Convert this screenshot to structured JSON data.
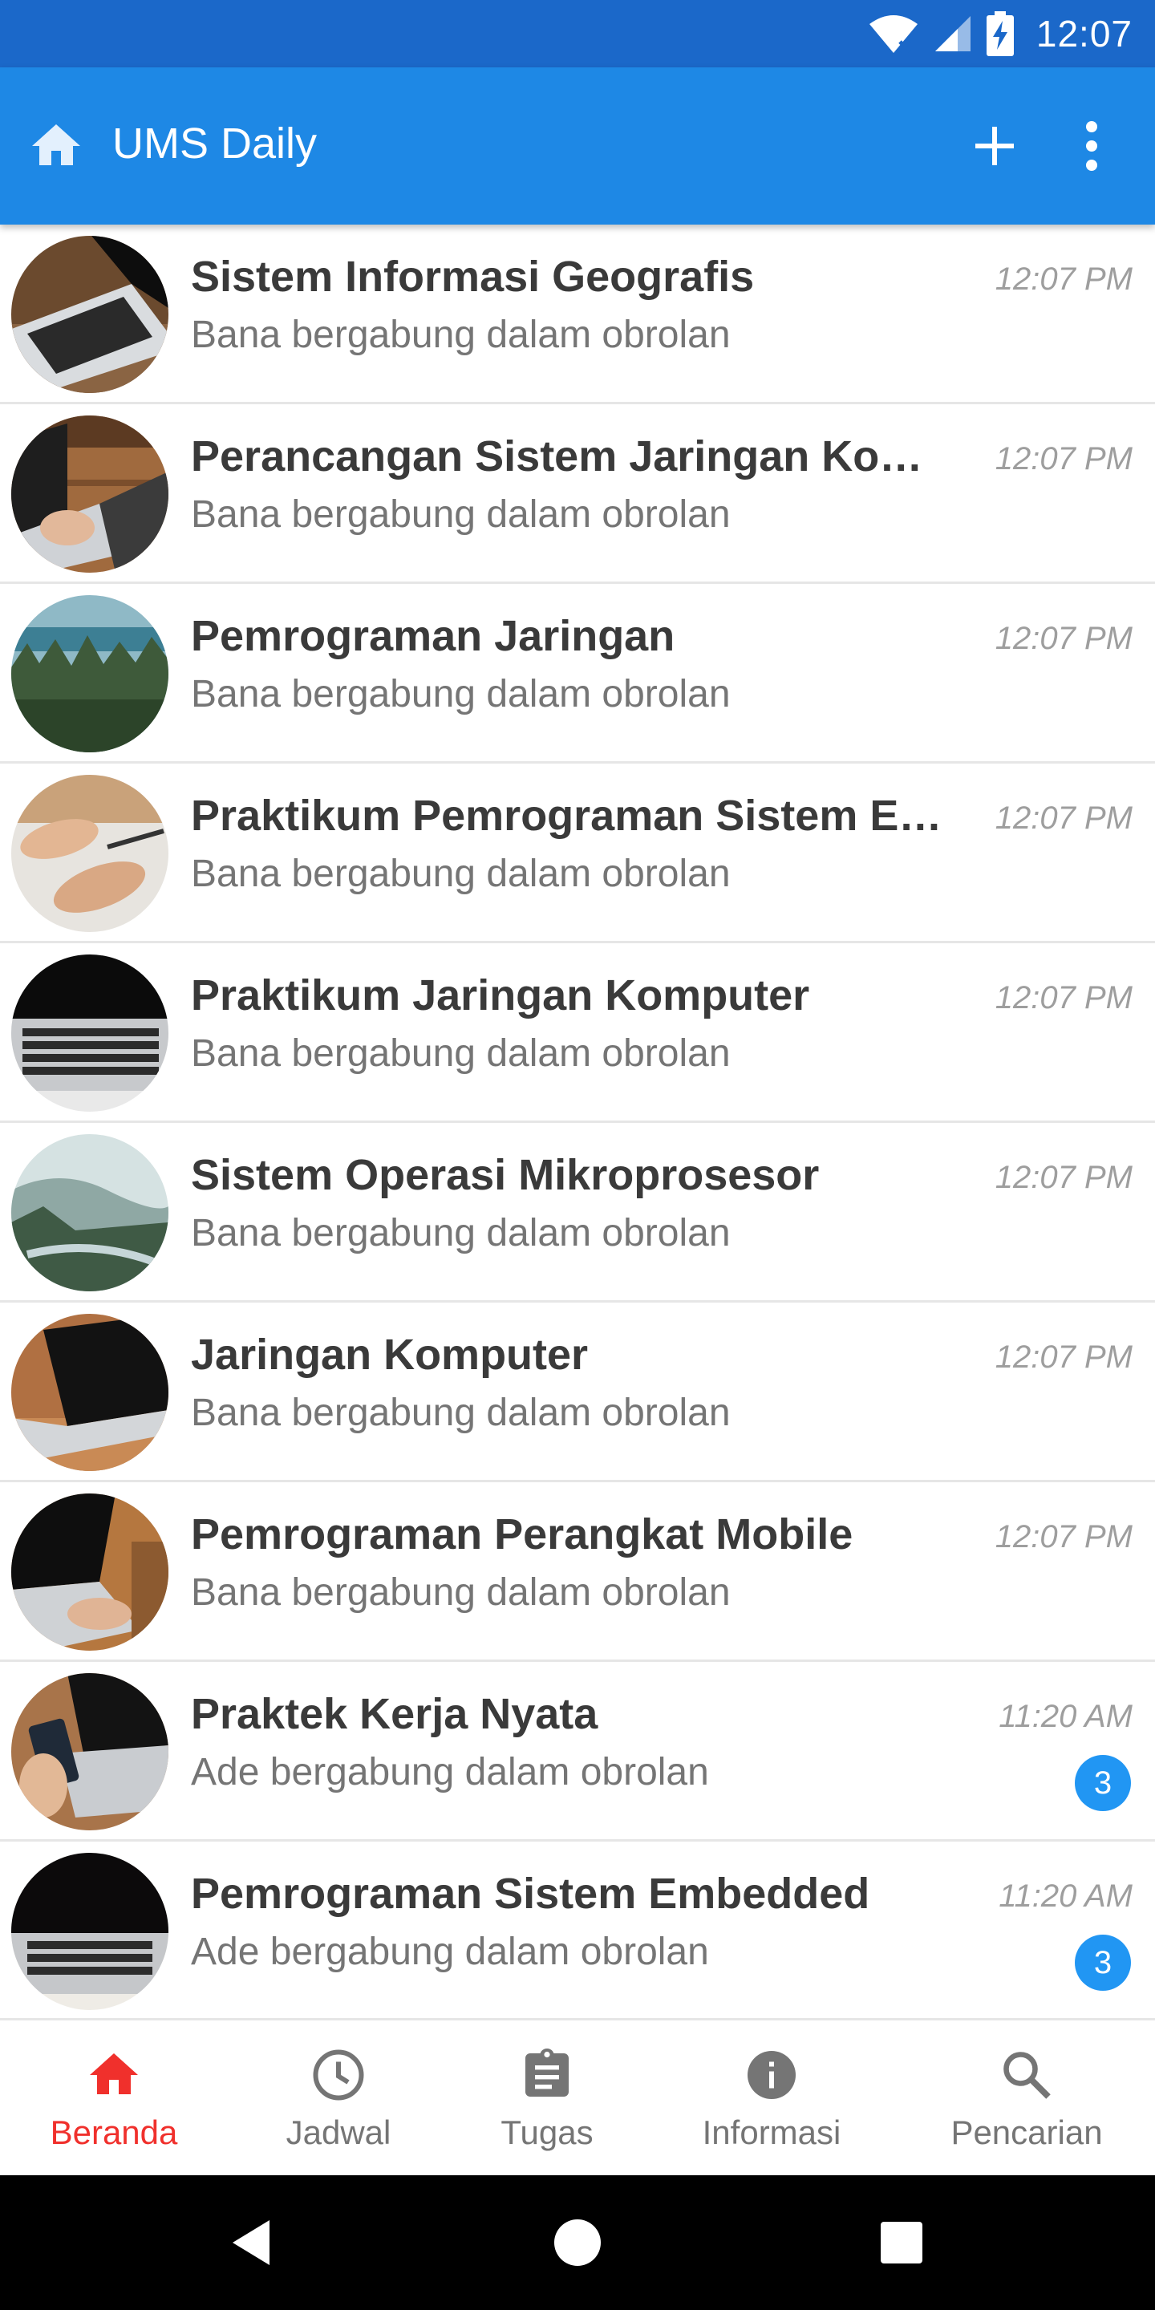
{
  "status_bar": {
    "time": "12:07"
  },
  "app_bar": {
    "title": "UMS Daily"
  },
  "chats": [
    {
      "name": "Sistem Informasi Geografis",
      "preview": "Bana bergabung dalam obrolan",
      "time": "12:07 PM",
      "unread": ""
    },
    {
      "name": "Perancangan Sistem Jaringan Komp...",
      "preview": "Bana bergabung dalam obrolan",
      "time": "12:07 PM",
      "unread": ""
    },
    {
      "name": "Pemrograman Jaringan",
      "preview": "Bana bergabung dalam obrolan",
      "time": "12:07 PM",
      "unread": ""
    },
    {
      "name": "Praktikum Pemrograman Sistem Em...",
      "preview": "Bana bergabung dalam obrolan",
      "time": "12:07 PM",
      "unread": ""
    },
    {
      "name": "Praktikum Jaringan Komputer",
      "preview": "Bana bergabung dalam obrolan",
      "time": "12:07 PM",
      "unread": ""
    },
    {
      "name": "Sistem Operasi Mikroprosesor",
      "preview": "Bana bergabung dalam obrolan",
      "time": "12:07 PM",
      "unread": ""
    },
    {
      "name": "Jaringan Komputer",
      "preview": "Bana bergabung dalam obrolan",
      "time": "12:07 PM",
      "unread": ""
    },
    {
      "name": "Pemrograman Perangkat Mobile",
      "preview": "Bana bergabung dalam obrolan",
      "time": "12:07 PM",
      "unread": ""
    },
    {
      "name": "Praktek Kerja Nyata",
      "preview": "Ade bergabung dalam obrolan",
      "time": "11:20 AM",
      "unread": "3"
    },
    {
      "name": "Pemrograman Sistem Embedded",
      "preview": "Ade bergabung dalam obrolan",
      "time": "11:20 AM",
      "unread": "3"
    }
  ],
  "bottom_nav": {
    "items": [
      {
        "label": "Beranda",
        "icon": "home-icon",
        "active": true
      },
      {
        "label": "Jadwal",
        "icon": "clock-icon",
        "active": false
      },
      {
        "label": "Tugas",
        "icon": "clipboard-icon",
        "active": false
      },
      {
        "label": "Informasi",
        "icon": "info-icon",
        "active": false
      },
      {
        "label": "Pencarian",
        "icon": "search-icon",
        "active": false
      }
    ]
  },
  "colors": {
    "status_bar": "#1b68c9",
    "app_bar": "#1e88e5",
    "active_nav": "#f0302c",
    "badge": "#2196f3"
  }
}
